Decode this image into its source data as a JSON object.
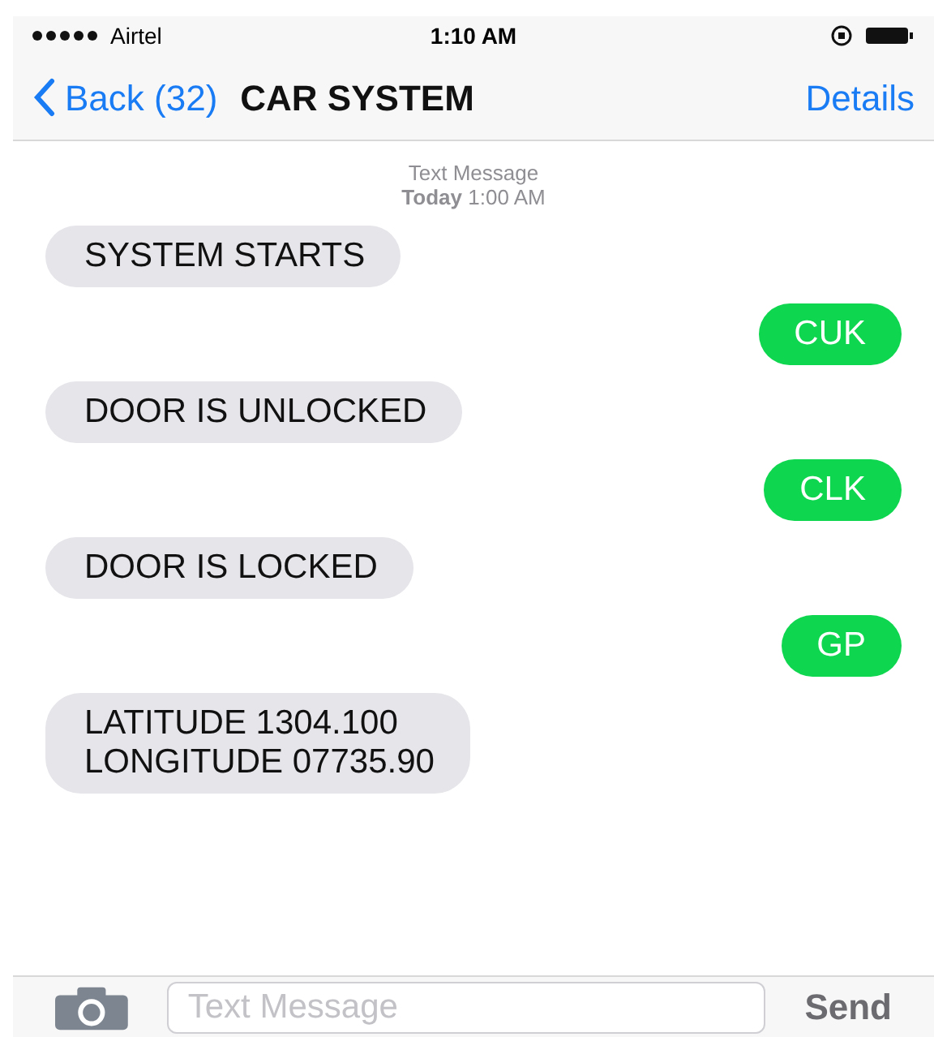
{
  "status_bar": {
    "carrier": "Airtel",
    "time": "1:10 AM"
  },
  "nav": {
    "back": "Back (32)",
    "title": "CAR SYSTEM",
    "action": "Details"
  },
  "thread_header": {
    "label": "Text Message",
    "date": "Today",
    "time": "1:00 AM"
  },
  "messages": [
    {
      "kind": "incoming",
      "lines": [
        "SYSTEM STARTS"
      ]
    },
    {
      "kind": "outgoing",
      "lines": [
        "CUK"
      ]
    },
    {
      "kind": "incoming",
      "lines": [
        "DOOR IS UNLOCKED"
      ]
    },
    {
      "kind": "outgoing",
      "lines": [
        "CLK"
      ]
    },
    {
      "kind": "incoming",
      "lines": [
        "DOOR IS LOCKED"
      ]
    },
    {
      "kind": "outgoing",
      "lines": [
        "GP"
      ]
    },
    {
      "kind": "incoming",
      "lines": [
        "LATITUDE 1304.100",
        "LONGITUDE 07735.90"
      ]
    }
  ],
  "composer": {
    "placeholder": "Text Message",
    "send": "Send"
  }
}
